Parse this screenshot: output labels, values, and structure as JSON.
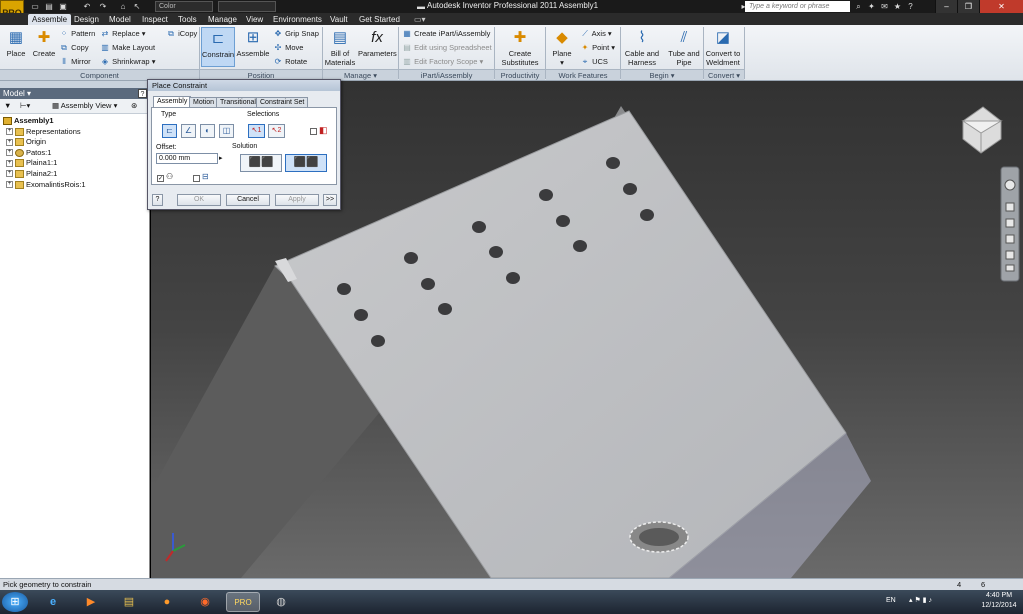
{
  "window": {
    "app_button_label": "PRO",
    "title": "Autodesk Inventor Professional 2011   Assembly1",
    "search_placeholder": "Type a keyword or phrase",
    "qat_color_value": "Color"
  },
  "tabs": [
    "Assemble",
    "Design",
    "Model",
    "Inspect",
    "Tools",
    "Manage",
    "View",
    "Environments",
    "Vault",
    "Get Started"
  ],
  "ribbon": {
    "component": {
      "title": "Component",
      "place": "Place",
      "create": "Create",
      "pattern": "Pattern",
      "copy": "Copy",
      "mirror": "Mirror",
      "replace": "Replace",
      "make_layout": "Make Layout",
      "shrinkwrap": "Shrinkwrap",
      "icopy": "iCopy"
    },
    "position": {
      "title": "Position",
      "constrain": "Constrain",
      "assemble": "Assemble",
      "grip_snap": "Grip Snap",
      "move": "Move",
      "rotate": "Rotate"
    },
    "manage": {
      "title": "Manage",
      "bill_line1": "Bill of",
      "bill_line2": "Materials",
      "parameters": "Parameters"
    },
    "ipart": {
      "title": "iPart/iAssembly",
      "create": "Create iPart/iAssembly",
      "edit_spreadsheet": "Edit using Spreadsheet",
      "edit_factory": "Edit Factory Scope"
    },
    "productivity": {
      "title": "Productivity",
      "line1": "Create",
      "line2": "Substitutes"
    },
    "work_features": {
      "title": "Work Features",
      "plane": "Plane",
      "axis": "Axis",
      "point": "Point",
      "ucs": "UCS"
    },
    "begin": {
      "title": "Begin",
      "cable_line1": "Cable and",
      "cable_line2": "Harness",
      "tube_line1": "Tube and",
      "tube_line2": "Pipe"
    },
    "convert": {
      "title": "Convert",
      "line1": "Convert to",
      "line2": "Weldment"
    }
  },
  "browser": {
    "title": "Model",
    "view_label": "Assembly View",
    "root": "Assembly1",
    "items": [
      "Representations",
      "Origin",
      "Patos:1",
      "Plaina1:1",
      "Plaina2:1",
      "ExomalintisRois:1"
    ]
  },
  "dialog": {
    "title": "Place Constraint",
    "tabs": [
      "Assembly",
      "Motion",
      "Transitional",
      "Constraint Set"
    ],
    "type_label": "Type",
    "selections_label": "Selections",
    "offset_label": "Offset:",
    "offset_value": "0.000 mm",
    "solution_label": "Solution",
    "sel1": "1",
    "sel2": "2",
    "ok": "OK",
    "cancel": "Cancel",
    "apply": "Apply",
    "more": ">>",
    "help": "?"
  },
  "status": {
    "message": "Pick geometry to constrain",
    "count1": "4",
    "count2": "6"
  },
  "taskbar": {
    "lang": "EN",
    "time": "4:40 PM",
    "date": "12/12/2014"
  },
  "colors": {
    "viewport_bg": "#4a4a4a",
    "part_face": "#c4c6c8",
    "accent": "#2a6ab0"
  }
}
